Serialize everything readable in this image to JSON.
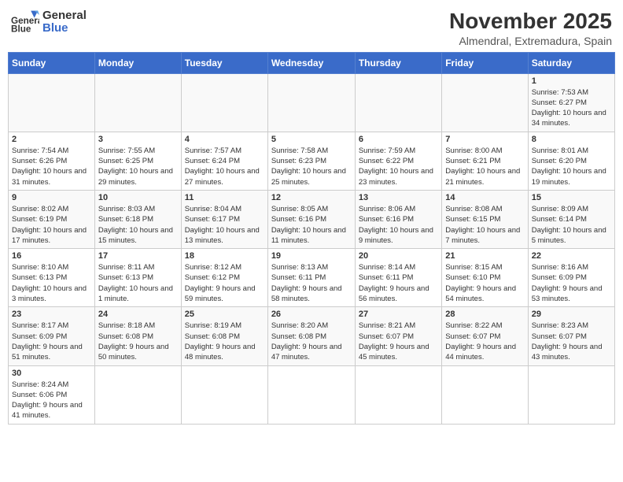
{
  "logo": {
    "line1": "General",
    "line2": "Blue"
  },
  "title": "November 2025",
  "subtitle": "Almendral, Extremadura, Spain",
  "days_of_week": [
    "Sunday",
    "Monday",
    "Tuesday",
    "Wednesday",
    "Thursday",
    "Friday",
    "Saturday"
  ],
  "weeks": [
    [
      {
        "day": "",
        "info": ""
      },
      {
        "day": "",
        "info": ""
      },
      {
        "day": "",
        "info": ""
      },
      {
        "day": "",
        "info": ""
      },
      {
        "day": "",
        "info": ""
      },
      {
        "day": "",
        "info": ""
      },
      {
        "day": "1",
        "info": "Sunrise: 7:53 AM\nSunset: 6:27 PM\nDaylight: 10 hours and 34 minutes."
      }
    ],
    [
      {
        "day": "2",
        "info": "Sunrise: 7:54 AM\nSunset: 6:26 PM\nDaylight: 10 hours and 31 minutes."
      },
      {
        "day": "3",
        "info": "Sunrise: 7:55 AM\nSunset: 6:25 PM\nDaylight: 10 hours and 29 minutes."
      },
      {
        "day": "4",
        "info": "Sunrise: 7:57 AM\nSunset: 6:24 PM\nDaylight: 10 hours and 27 minutes."
      },
      {
        "day": "5",
        "info": "Sunrise: 7:58 AM\nSunset: 6:23 PM\nDaylight: 10 hours and 25 minutes."
      },
      {
        "day": "6",
        "info": "Sunrise: 7:59 AM\nSunset: 6:22 PM\nDaylight: 10 hours and 23 minutes."
      },
      {
        "day": "7",
        "info": "Sunrise: 8:00 AM\nSunset: 6:21 PM\nDaylight: 10 hours and 21 minutes."
      },
      {
        "day": "8",
        "info": "Sunrise: 8:01 AM\nSunset: 6:20 PM\nDaylight: 10 hours and 19 minutes."
      }
    ],
    [
      {
        "day": "9",
        "info": "Sunrise: 8:02 AM\nSunset: 6:19 PM\nDaylight: 10 hours and 17 minutes."
      },
      {
        "day": "10",
        "info": "Sunrise: 8:03 AM\nSunset: 6:18 PM\nDaylight: 10 hours and 15 minutes."
      },
      {
        "day": "11",
        "info": "Sunrise: 8:04 AM\nSunset: 6:17 PM\nDaylight: 10 hours and 13 minutes."
      },
      {
        "day": "12",
        "info": "Sunrise: 8:05 AM\nSunset: 6:16 PM\nDaylight: 10 hours and 11 minutes."
      },
      {
        "day": "13",
        "info": "Sunrise: 8:06 AM\nSunset: 6:16 PM\nDaylight: 10 hours and 9 minutes."
      },
      {
        "day": "14",
        "info": "Sunrise: 8:08 AM\nSunset: 6:15 PM\nDaylight: 10 hours and 7 minutes."
      },
      {
        "day": "15",
        "info": "Sunrise: 8:09 AM\nSunset: 6:14 PM\nDaylight: 10 hours and 5 minutes."
      }
    ],
    [
      {
        "day": "16",
        "info": "Sunrise: 8:10 AM\nSunset: 6:13 PM\nDaylight: 10 hours and 3 minutes."
      },
      {
        "day": "17",
        "info": "Sunrise: 8:11 AM\nSunset: 6:13 PM\nDaylight: 10 hours and 1 minute."
      },
      {
        "day": "18",
        "info": "Sunrise: 8:12 AM\nSunset: 6:12 PM\nDaylight: 9 hours and 59 minutes."
      },
      {
        "day": "19",
        "info": "Sunrise: 8:13 AM\nSunset: 6:11 PM\nDaylight: 9 hours and 58 minutes."
      },
      {
        "day": "20",
        "info": "Sunrise: 8:14 AM\nSunset: 6:11 PM\nDaylight: 9 hours and 56 minutes."
      },
      {
        "day": "21",
        "info": "Sunrise: 8:15 AM\nSunset: 6:10 PM\nDaylight: 9 hours and 54 minutes."
      },
      {
        "day": "22",
        "info": "Sunrise: 8:16 AM\nSunset: 6:09 PM\nDaylight: 9 hours and 53 minutes."
      }
    ],
    [
      {
        "day": "23",
        "info": "Sunrise: 8:17 AM\nSunset: 6:09 PM\nDaylight: 9 hours and 51 minutes."
      },
      {
        "day": "24",
        "info": "Sunrise: 8:18 AM\nSunset: 6:08 PM\nDaylight: 9 hours and 50 minutes."
      },
      {
        "day": "25",
        "info": "Sunrise: 8:19 AM\nSunset: 6:08 PM\nDaylight: 9 hours and 48 minutes."
      },
      {
        "day": "26",
        "info": "Sunrise: 8:20 AM\nSunset: 6:08 PM\nDaylight: 9 hours and 47 minutes."
      },
      {
        "day": "27",
        "info": "Sunrise: 8:21 AM\nSunset: 6:07 PM\nDaylight: 9 hours and 45 minutes."
      },
      {
        "day": "28",
        "info": "Sunrise: 8:22 AM\nSunset: 6:07 PM\nDaylight: 9 hours and 44 minutes."
      },
      {
        "day": "29",
        "info": "Sunrise: 8:23 AM\nSunset: 6:07 PM\nDaylight: 9 hours and 43 minutes."
      }
    ],
    [
      {
        "day": "30",
        "info": "Sunrise: 8:24 AM\nSunset: 6:06 PM\nDaylight: 9 hours and 41 minutes."
      },
      {
        "day": "",
        "info": ""
      },
      {
        "day": "",
        "info": ""
      },
      {
        "day": "",
        "info": ""
      },
      {
        "day": "",
        "info": ""
      },
      {
        "day": "",
        "info": ""
      },
      {
        "day": "",
        "info": ""
      }
    ]
  ]
}
